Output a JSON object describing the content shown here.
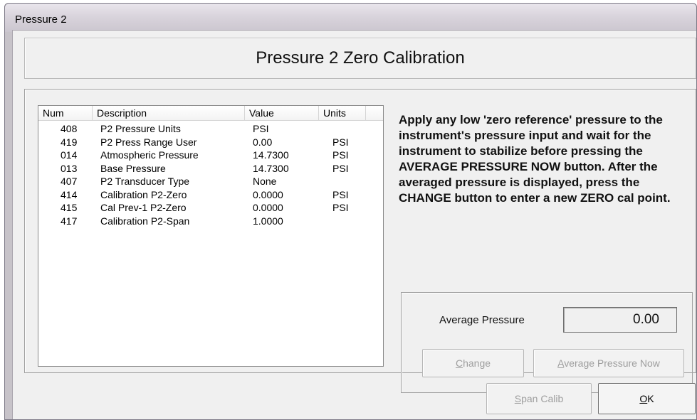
{
  "window": {
    "title": "Pressure 2"
  },
  "header": {
    "title": "Pressure 2 Zero Calibration"
  },
  "table": {
    "columns": [
      "Num",
      "Description",
      "Value",
      "Units"
    ],
    "rows": [
      {
        "num": "408",
        "description": "P2 Pressure Units",
        "value": "PSI",
        "units": ""
      },
      {
        "num": "419",
        "description": "P2 Press Range User",
        "value": "0.00",
        "units": "PSI"
      },
      {
        "num": "014",
        "description": "Atmospheric Pressure",
        "value": "14.7300",
        "units": "PSI"
      },
      {
        "num": "013",
        "description": "Base Pressure",
        "value": "14.7300",
        "units": "PSI"
      },
      {
        "num": "407",
        "description": "P2 Transducer Type",
        "value": "None",
        "units": ""
      },
      {
        "num": "414",
        "description": "Calibration P2-Zero",
        "value": "0.0000",
        "units": "PSI"
      },
      {
        "num": "415",
        "description": "Cal Prev-1 P2-Zero",
        "value": "0.0000",
        "units": "PSI"
      },
      {
        "num": "417",
        "description": "Calibration P2-Span",
        "value": "1.0000",
        "units": ""
      }
    ]
  },
  "instructions": {
    "text": "Apply any low 'zero reference' pressure to the instrument's pressure input and wait for the instrument to stabilize before pressing the AVERAGE PRESSURE NOW button. After the averaged pressure is displayed, press the CHANGE button to enter a new ZERO cal point."
  },
  "average": {
    "label": "Average Pressure",
    "value": "0.00",
    "change_first": "C",
    "change_rest": "hange",
    "avg_now_first": "A",
    "avg_now_rest": "verage Pressure Now"
  },
  "footer": {
    "span_first": "S",
    "span_rest": "pan Calib",
    "ok_first": "O",
    "ok_rest": "K"
  }
}
